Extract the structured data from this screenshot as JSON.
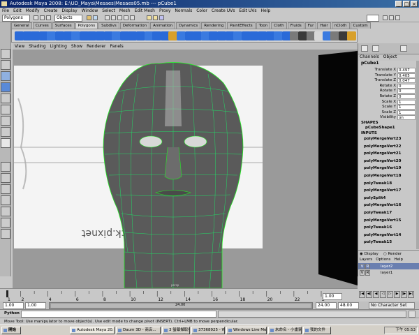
{
  "window": {
    "title": "Autodesk Maya 2008: E:\\UD_Maya\\Mesaes\\Mesaes05.mb   ---   pCube1",
    "minimize": "_",
    "maximize": "□",
    "close": "×"
  },
  "menubar": [
    "File",
    "Edit",
    "Modify",
    "Create",
    "Display",
    "Window",
    "Select",
    "Mesh",
    "Edit Mesh",
    "Proxy",
    "Normals",
    "Color",
    "Create UVs",
    "Edit UVs",
    "Help"
  ],
  "statusline": {
    "mode_select": "Polygons",
    "objects_label": "Objects"
  },
  "shelf_tabs": [
    "General",
    "Curves",
    "Surfaces",
    "Polygons",
    "Subdivs",
    "Deformation",
    "Animation",
    "Dynamics",
    "Rendering",
    "PaintEffects",
    "Toon",
    "Cloth",
    "Fluids",
    "Fur",
    "Hair",
    "nCloth",
    "Custom"
  ],
  "shelf_active_tab": "Polygons",
  "viewport": {
    "menu": [
      "View",
      "Shading",
      "Lighting",
      "Show",
      "Renderer",
      "Panels"
    ],
    "watermark": "http://ggrock.pixnet",
    "object_label": "persp"
  },
  "channel_box": {
    "tabs": [
      "Channels",
      "Object"
    ],
    "object_name": "pCube1",
    "attributes": [
      {
        "name": "Translate X",
        "value": "0.497"
      },
      {
        "name": "Translate Y",
        "value": "0.405"
      },
      {
        "name": "Translate Z",
        "value": "0.047"
      },
      {
        "name": "Rotate X",
        "value": "0"
      },
      {
        "name": "Rotate Y",
        "value": "0"
      },
      {
        "name": "Rotate Z",
        "value": "0"
      },
      {
        "name": "Scale X",
        "value": "1"
      },
      {
        "name": "Scale Y",
        "value": "1"
      },
      {
        "name": "Scale Z",
        "value": "1"
      },
      {
        "name": "Visibility",
        "value": "on"
      }
    ],
    "shapes_header": "SHAPES",
    "shape_name": "pCubeShape1",
    "inputs_header": "INPUTS",
    "history": [
      "polyMergeVert23",
      "polyMergeVert22",
      "polyMergeVert21",
      "polyMergeVert20",
      "polyMergeVert19",
      "polyMergeVert18",
      "polyTweak18",
      "polyMergeVert17",
      "polySplit4",
      "polyMergeVert16",
      "polyTweak17",
      "polyMergeVert15",
      "polyTweak16",
      "polyMergeVert14",
      "polyTweak15"
    ]
  },
  "layer_editor": {
    "radio_display": "Display",
    "radio_render": "Render",
    "menu": [
      "Layers",
      "Options",
      "Help"
    ],
    "layers": [
      {
        "v": "V",
        "p": "R",
        "name": "layer2"
      },
      {
        "v": "V",
        "p": "R",
        "name": "layer1"
      }
    ]
  },
  "timeline": {
    "ticks": [
      "1",
      "2",
      "4",
      "6",
      "8",
      "10",
      "12",
      "14",
      "16",
      "18",
      "20",
      "22",
      "24"
    ],
    "current_frame": "1.00"
  },
  "range": {
    "start": "1.00",
    "playback_start": "1.00",
    "slider_label": "24.00",
    "playback_end": "24.00",
    "end": "48.00",
    "character_set": "No Character Set"
  },
  "cmdline": {
    "label": "Python"
  },
  "helpline": "Move Tool: Use manipulator to move object(s). Use edit mode to change pivot (INSERT). Ctrl+LMB to move perpendicular.",
  "taskbar": {
    "items": [
      "開始",
      "Autodesk Maya 20...",
      "Daum 3D - 商店...",
      "3 螢幕擷取參考",
      "37368925 - Windo...",
      "Windows Live Mes...",
      "未命名 - 小畫家",
      "我的文件"
    ],
    "clock": "下午 05:53"
  }
}
